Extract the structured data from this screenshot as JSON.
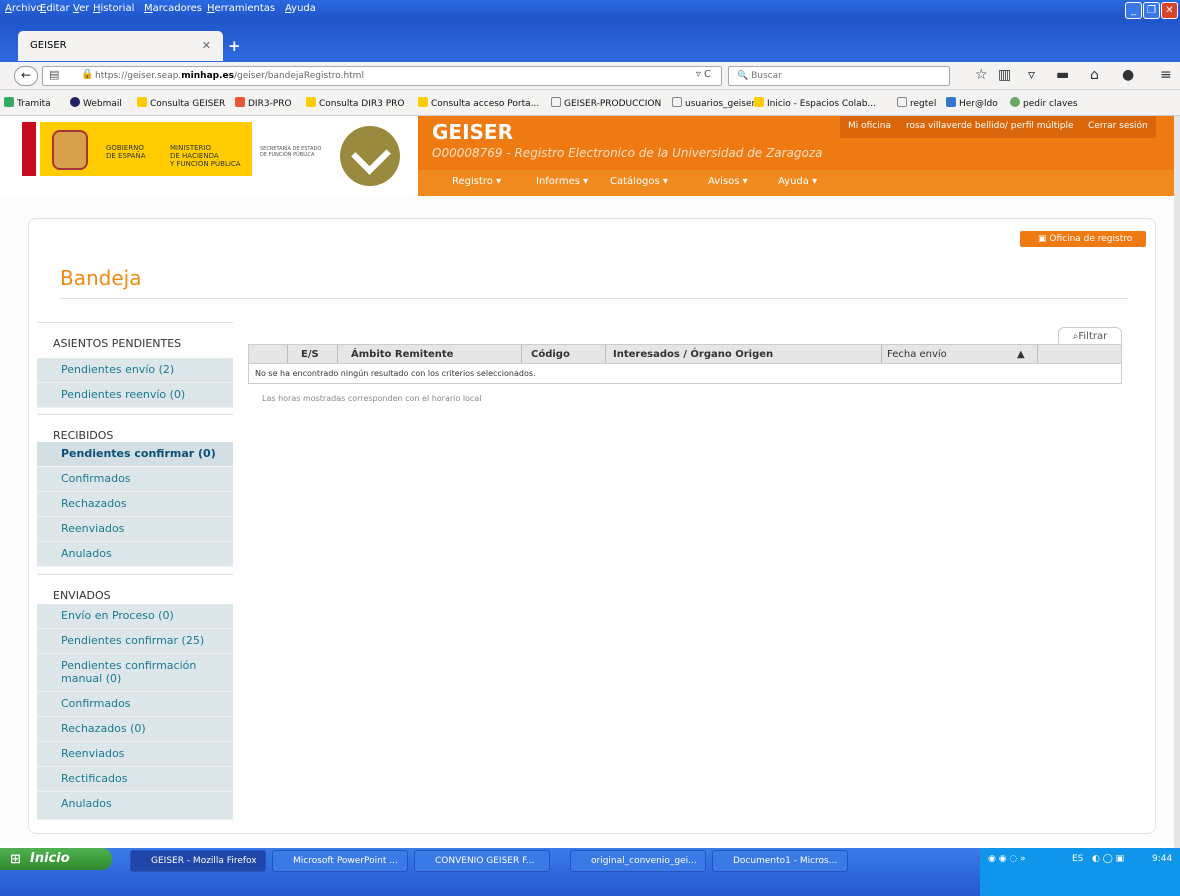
{
  "menubar": {
    "items": [
      "Archivo",
      "Editar",
      "Ver",
      "Historial",
      "Marcadores",
      "Herramientas",
      "Ayuda"
    ]
  },
  "tab": {
    "title": "GEISER"
  },
  "address": {
    "url_pre": "https://geiser.seap.",
    "url_bold": "minhap.es",
    "url_post": "/geiser/bandejaRegistro.html",
    "search_placeholder": "Buscar"
  },
  "bookmarks": [
    {
      "label": "Tramita",
      "icon": "tramita-icon"
    },
    {
      "label": "Webmail",
      "icon": "webmail-icon"
    },
    {
      "label": "Consulta GEISER",
      "icon": "gov-icon"
    },
    {
      "label": "DIR3-PRO",
      "icon": "warning-icon"
    },
    {
      "label": "Consulta DIR3 PRO",
      "icon": "gov-icon"
    },
    {
      "label": "Consulta acceso Porta...",
      "icon": "gov-icon"
    },
    {
      "label": "GEISER-PRODUCCION",
      "icon": "folder-icon"
    },
    {
      "label": "usuarios_geiser",
      "icon": "folder-icon"
    },
    {
      "label": "Inicio - Espacios Colab...",
      "icon": "gov-icon"
    },
    {
      "label": "regtel",
      "icon": "folder-icon"
    },
    {
      "label": "Her@ldo",
      "icon": "heraldo-icon"
    },
    {
      "label": "pedir claves",
      "icon": "key-icon"
    }
  ],
  "header": {
    "gov1": "GOBIERNO\nDE ESPAÑA",
    "gov2": "MINISTERIO\nDE HACIENDA\nY FUNCIÓN PÚBLICA",
    "sec": "SECRETARÍA DE ESTADO\nDE FUNCIÓN PÚBLICA",
    "app_title": "GEISER",
    "app_sub": "O00008769 - Registro Electronico de la Universidad de Zaragoza",
    "mi_oficina": "Mi oficina",
    "user": "rosa villaverde bellido/ perfil múltiple",
    "logout": "Cerrar sesión",
    "nav": [
      "Registro",
      "Informes",
      "Catálogos",
      "Avisos",
      "Ayuda"
    ]
  },
  "page": {
    "oficina_btn": "Oficina de registro",
    "title": "Bandeja",
    "filtrar": "Filtrar",
    "columns": [
      "E/S",
      "Ámbito Remitente",
      "Código",
      "Interesados / Órgano Origen",
      "Fecha envío"
    ],
    "no_results": "No se ha encontrado ningún resultado con los criterios seleccionados.",
    "note": "Las horas mostradas corresponden con el horario local"
  },
  "sidebar": {
    "sections": [
      {
        "title": "ASIENTOS PENDIENTES",
        "items": [
          {
            "label": "Pendientes envío (2)"
          },
          {
            "label": "Pendientes reenvío (0)"
          }
        ]
      },
      {
        "title": "RECIBIDOS",
        "items": [
          {
            "label": "Pendientes confirmar (0)",
            "active": true
          },
          {
            "label": "Confirmados"
          },
          {
            "label": "Rechazados"
          },
          {
            "label": "Reenviados"
          },
          {
            "label": "Anulados"
          }
        ]
      },
      {
        "title": "ENVIADOS",
        "items": [
          {
            "label": "Envío en Proceso (0)"
          },
          {
            "label": "Pendientes confirmar (25)"
          },
          {
            "label": "Pendientes confirmación manual (0)"
          },
          {
            "label": "Confirmados"
          },
          {
            "label": "Rechazados (0)"
          },
          {
            "label": "Reenviados"
          },
          {
            "label": "Rectificados"
          },
          {
            "label": "Anulados"
          }
        ]
      }
    ]
  },
  "taskbar": {
    "start": "Inicio",
    "tasks": [
      "GEISER - Mozilla Firefox",
      "Microsoft PowerPoint ...",
      "CONVENIO GEISER F...",
      "original_convenio_gei...",
      "Documento1 - Micros..."
    ],
    "lang": "ES",
    "time": "9:44"
  },
  "colors": {
    "accent": "#ef7a12",
    "sidebar_bg": "#dde6e8",
    "link": "#1b7a93"
  }
}
